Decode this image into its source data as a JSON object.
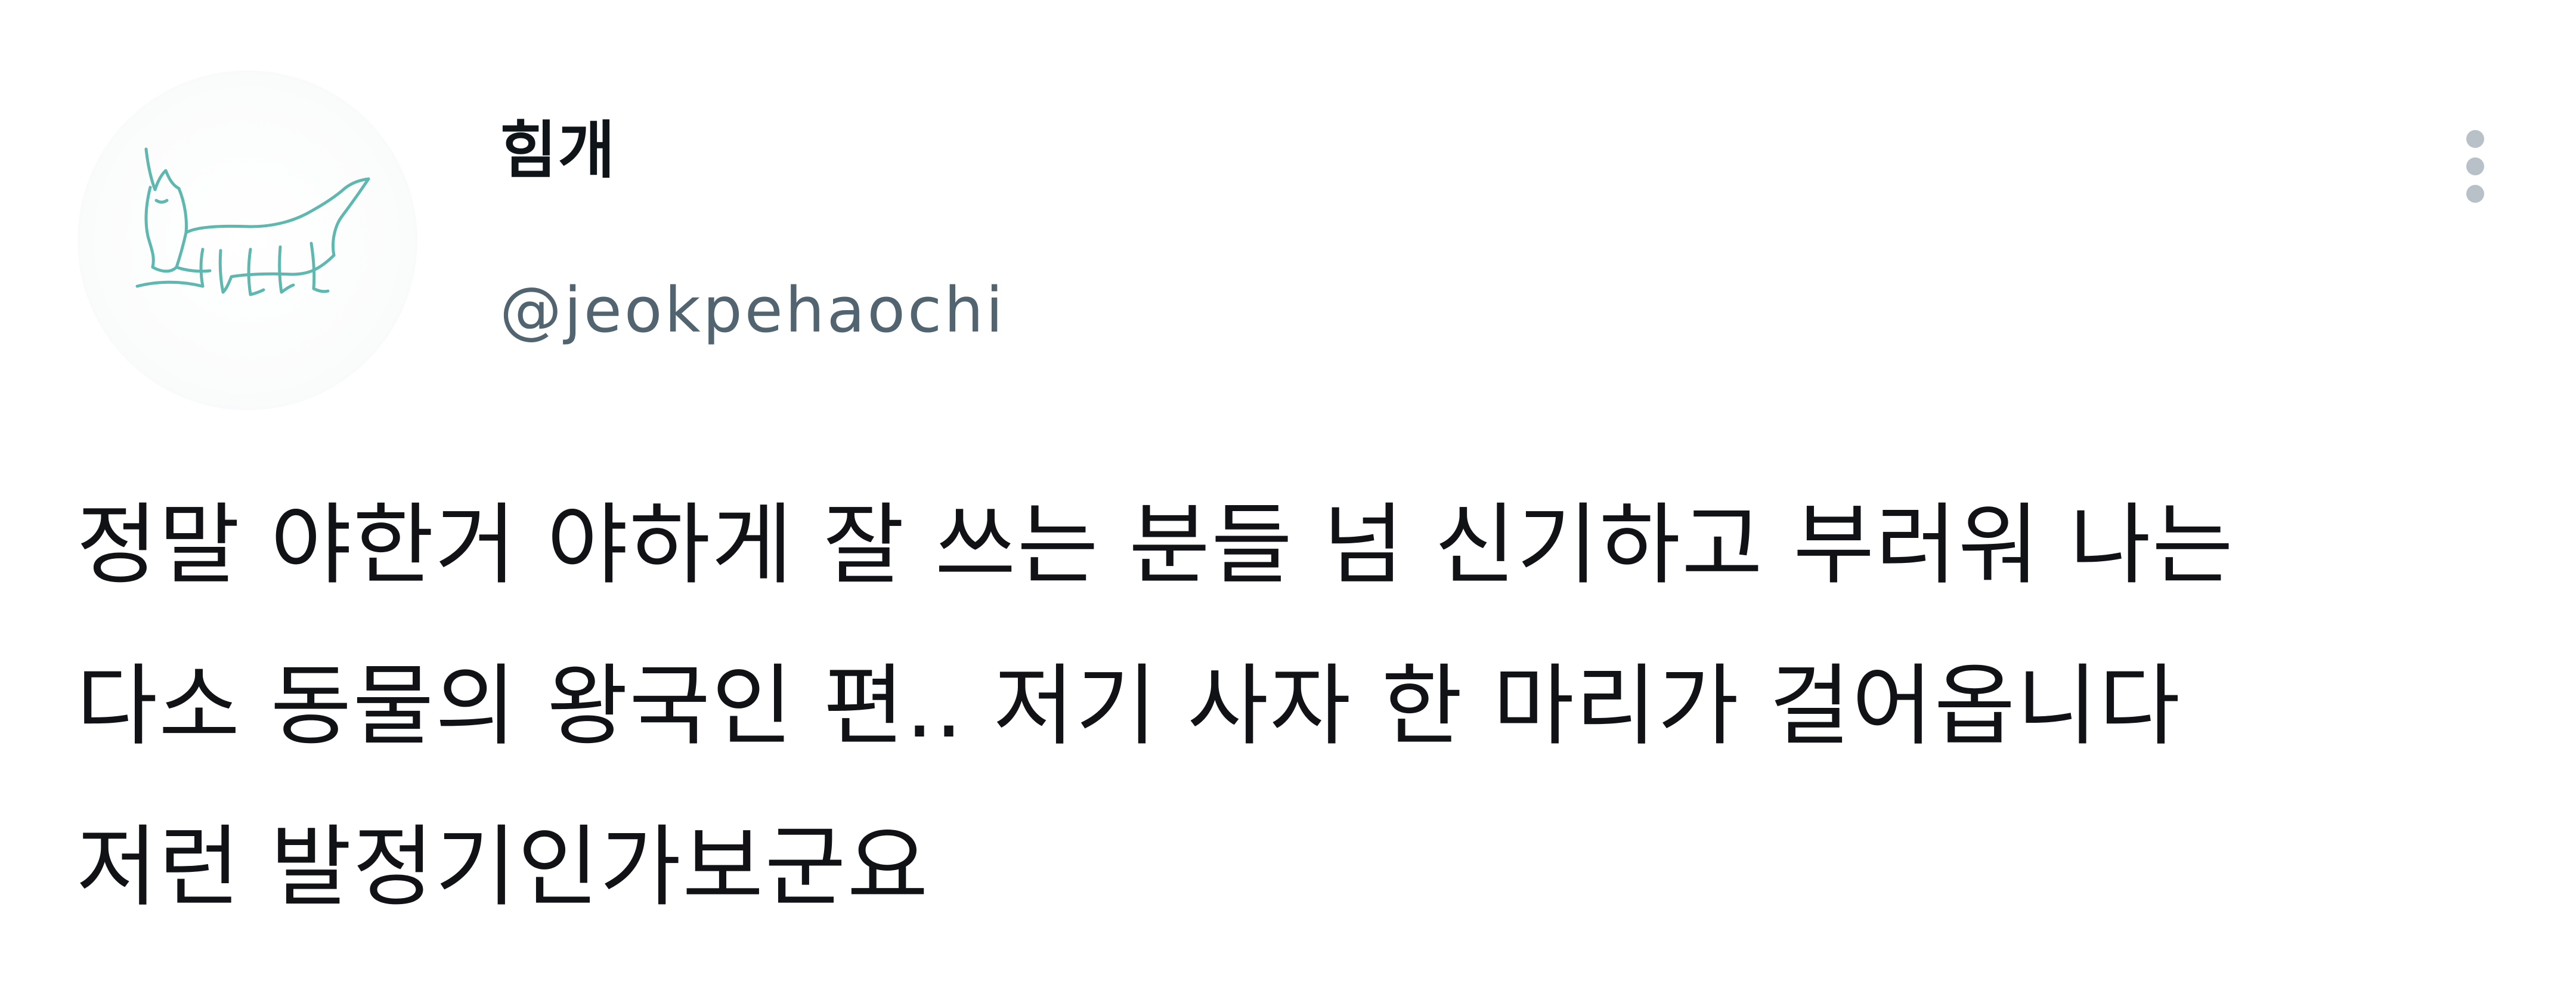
{
  "author": {
    "display_name": "힘개",
    "handle": "@jeokpehaochi"
  },
  "post": {
    "lines": [
      "정말 야한거 야하게 잘 쓰는 분들 넘 신기하고 부러워 나는",
      "다소 동물의 왕국인 편.. 저기 사자 한 마리가 걸어옵니다",
      "저런 발정기인가보군요"
    ]
  },
  "icons": {
    "avatar": "doodle-dog-drawing",
    "more": "vertical-ellipsis-icon"
  },
  "colors": {
    "handle": "#536471",
    "more_dots": "#b9c1c8",
    "avatar_stroke": "#5fb8b0",
    "text": "#0f1419"
  }
}
